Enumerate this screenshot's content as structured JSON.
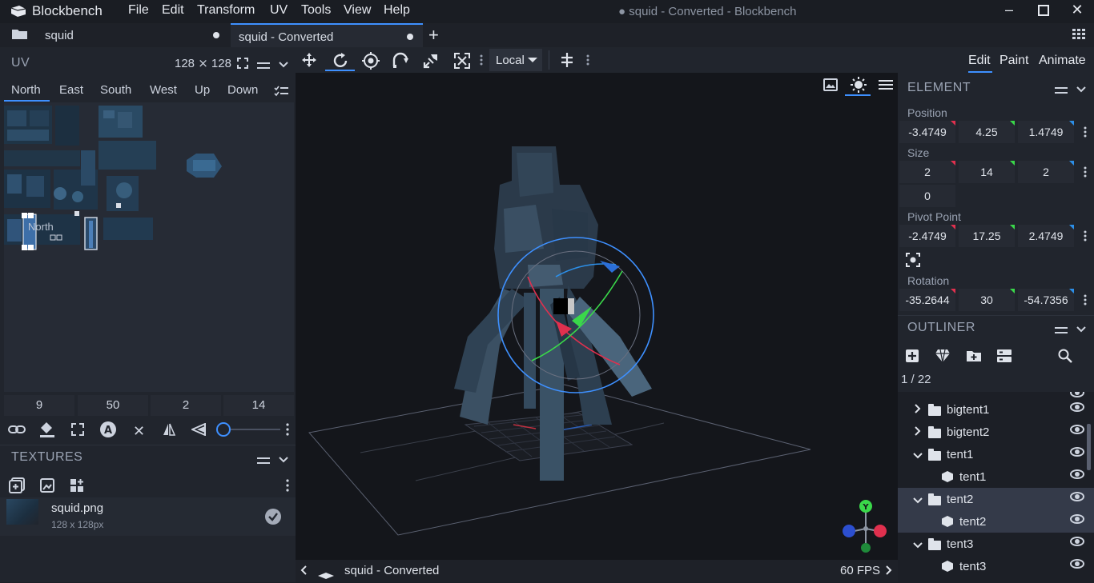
{
  "app": {
    "name": "Blockbench",
    "window_title": "● squid - Converted - Blockbench"
  },
  "menu": [
    "File",
    "Edit",
    "Transform",
    "UV",
    "Tools",
    "View",
    "Help"
  ],
  "tabs": [
    {
      "label": "squid",
      "active": false
    },
    {
      "label": "squid - Converted",
      "active": true
    }
  ],
  "uv_panel": {
    "title": "UV",
    "size": "128 ⨯ 128",
    "faces": [
      "North",
      "East",
      "South",
      "West",
      "Up",
      "Down"
    ],
    "active_face": "North",
    "overlay_label": "North",
    "inputs": [
      "9",
      "50",
      "2",
      "14"
    ]
  },
  "textures": {
    "title": "TEXTURES",
    "items": [
      {
        "name": "squid.png",
        "size": "128 x 128px"
      }
    ]
  },
  "toolbar": {
    "space": "Local"
  },
  "modes": [
    "Edit",
    "Paint",
    "Animate"
  ],
  "active_mode": "Edit",
  "element": {
    "title": "ELEMENT",
    "position_label": "Position",
    "position": [
      "-3.4749",
      "4.25",
      "1.4749"
    ],
    "size_label": "Size",
    "size": [
      "2",
      "14",
      "2"
    ],
    "inflate": "0",
    "pivot_label": "Pivot Point",
    "pivot": [
      "-2.4749",
      "17.25",
      "2.4749"
    ],
    "rotation_label": "Rotation",
    "rotation": [
      "-35.2644",
      "30",
      "-54.7356"
    ]
  },
  "outliner": {
    "title": "OUTLINER",
    "count": "1 / 22",
    "rows": [
      {
        "label": "bigtent1",
        "type": "group",
        "indent": 1,
        "expanded": false,
        "selected": false
      },
      {
        "label": "bigtent2",
        "type": "group",
        "indent": 1,
        "expanded": false,
        "selected": false
      },
      {
        "label": "tent1",
        "type": "group",
        "indent": 1,
        "expanded": true,
        "selected": false
      },
      {
        "label": "tent1",
        "type": "cube",
        "indent": 2,
        "expanded": false,
        "selected": false
      },
      {
        "label": "tent2",
        "type": "group",
        "indent": 1,
        "expanded": true,
        "selected": true
      },
      {
        "label": "tent2",
        "type": "cube",
        "indent": 2,
        "expanded": false,
        "selected": true
      },
      {
        "label": "tent3",
        "type": "group",
        "indent": 1,
        "expanded": true,
        "selected": false
      },
      {
        "label": "tent3",
        "type": "cube",
        "indent": 2,
        "expanded": false,
        "selected": false
      }
    ]
  },
  "viewport": {
    "model_name": "squid - Converted",
    "fps": "60 FPS"
  },
  "colors": {
    "accent": "#3e90ff",
    "bg": "#1c1f26",
    "panel": "#21252d",
    "x_axis": "#e0304e",
    "y_axis": "#3ad84a",
    "z_axis": "#2c8fe8"
  }
}
